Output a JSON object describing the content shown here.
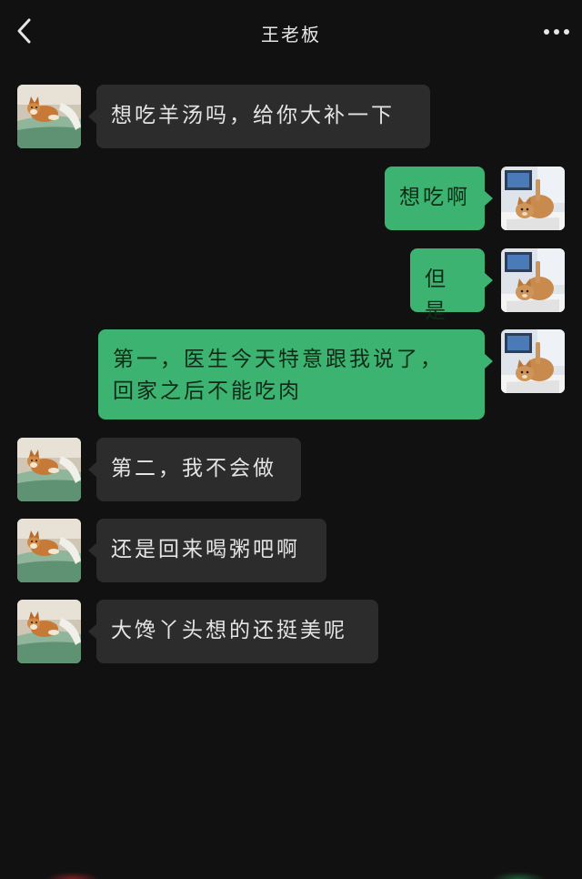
{
  "header": {
    "title": "王老板",
    "back_icon": "chevron-left-icon",
    "more_icon": "more-dots-icon"
  },
  "colors": {
    "background": "#111111",
    "incoming_bubble": "#2c2c2c",
    "outgoing_bubble": "#3cb371"
  },
  "messages": [
    {
      "side": "left",
      "avatar": "shiba-dog-bathtub-avatar",
      "text": "想吃羊汤吗，给你大补一下"
    },
    {
      "side": "right",
      "avatar": "cat-avatar",
      "text": "想吃啊"
    },
    {
      "side": "right",
      "avatar": "cat-avatar",
      "text": "但是"
    },
    {
      "side": "right",
      "avatar": "cat-avatar",
      "text": "第一，医生今天特意跟我说了，\n回家之后不能吃肉"
    },
    {
      "side": "left",
      "avatar": "shiba-dog-bathtub-avatar",
      "text": "第二，我不会做"
    },
    {
      "side": "left",
      "avatar": "shiba-dog-bathtub-avatar",
      "text": "还是回来喝粥吧啊"
    },
    {
      "side": "left",
      "avatar": "shiba-dog-bathtub-avatar",
      "text": "大馋丫头想的还挺美呢"
    }
  ]
}
